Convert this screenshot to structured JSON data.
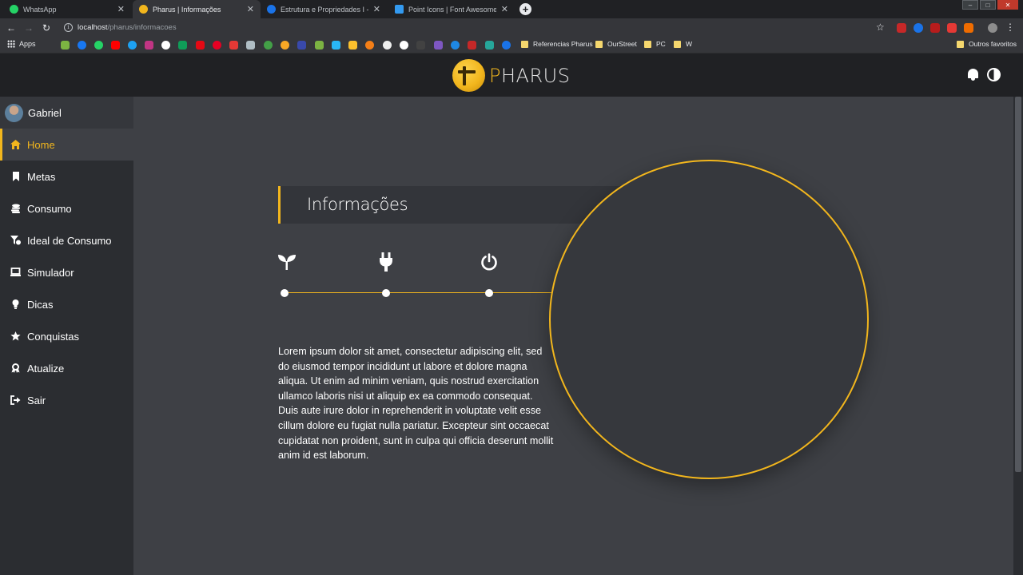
{
  "browser": {
    "tabs": [
      {
        "title": "WhatsApp",
        "color": "#25d366"
      },
      {
        "title": "Pharus | Informações",
        "color": "#f2b61d"
      },
      {
        "title": "Estrutura e Propriedades I - Quí",
        "color": "#1a73e8"
      },
      {
        "title": "Point Icons | Font Awesome",
        "color": "#339af0"
      }
    ],
    "url_host": "localhost",
    "url_path": "/pharus/informacoes",
    "bookmarks": {
      "apps_label": "Apps",
      "folders": [
        "Referencias Pharus",
        "OurStreet",
        "PC",
        "W"
      ],
      "other_label": "Outros favoritos"
    }
  },
  "app": {
    "brand_initial": "P",
    "brand_rest": "HARUS",
    "accent_color": "#f2b61d",
    "user": {
      "name": "Gabriel"
    },
    "menu": [
      {
        "label": "Home",
        "icon": "home-icon",
        "active": true
      },
      {
        "label": "Metas",
        "icon": "bookmark-icon"
      },
      {
        "label": "Consumo",
        "icon": "coins-icon"
      },
      {
        "label": "Ideal de Consumo",
        "icon": "filter-dollar-icon"
      },
      {
        "label": "Simulador",
        "icon": "laptop-icon"
      },
      {
        "label": "Dicas",
        "icon": "lightbulb-icon"
      },
      {
        "label": "Conquistas",
        "icon": "star-icon"
      },
      {
        "label": "Atualize",
        "icon": "award-icon"
      },
      {
        "label": "Sair",
        "icon": "sign-out-icon"
      }
    ],
    "page": {
      "title": "Informações",
      "features": [
        {
          "icon": "seedling-icon"
        },
        {
          "icon": "plug-icon"
        },
        {
          "icon": "power-icon"
        }
      ],
      "body": "Lorem ipsum dolor sit amet, consectetur adipiscing elit, sed do eiusmod tempor incididunt ut labore et dolore magna aliqua. Ut enim ad minim veniam, quis nostrud exercitation ullamco laboris nisi ut aliquip ex ea commodo consequat. Duis aute irure dolor in reprehenderit in voluptate velit esse cillum dolore eu fugiat nulla pariatur. Excepteur sint occaecat cupidatat non proident, sunt in culpa qui officia deserunt mollit anim id est laborum."
    }
  }
}
